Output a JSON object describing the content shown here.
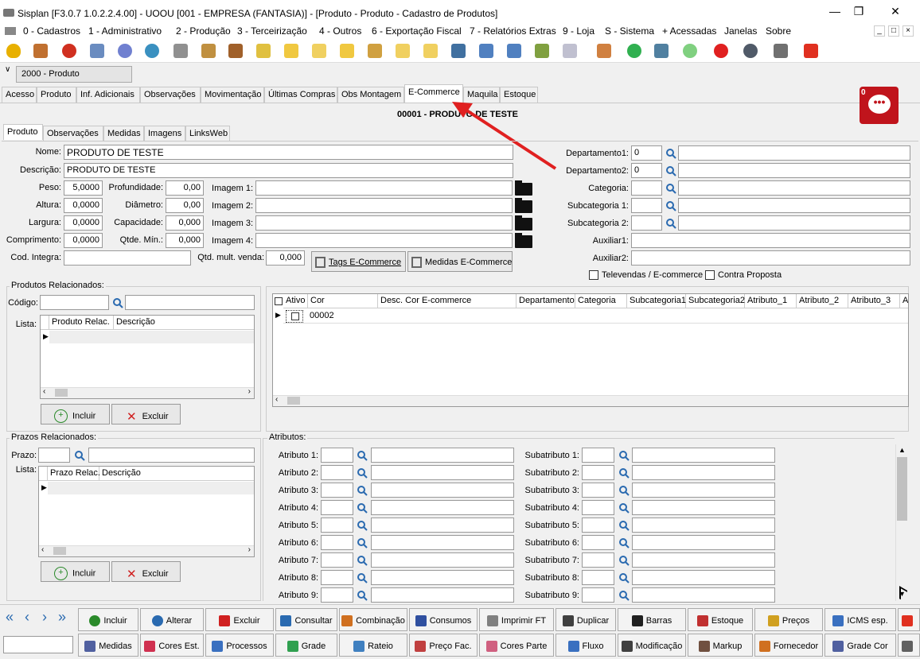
{
  "window": {
    "title": "Sisplan [F3.0.7 1.0.2.2.4.00] - UOOU [001 - EMPRESA (FANTASIA)] - [Produto - Produto - Cadastro de Produtos]"
  },
  "menu": [
    "0 - Cadastros",
    "1 - Administrativo",
    "2 - Produção",
    "3 - Terceirização",
    "4 - Outros",
    "6 - Exportação Fiscal",
    "7 - Relatórios Extras",
    "9 - Loja",
    "S - Sistema",
    "+ Acessadas",
    "Janelas",
    "Sobre"
  ],
  "form_selector": "2000 - Produto",
  "tabs": [
    "Acesso",
    "Produto",
    "Inf. Adicionais",
    "Observações",
    "Movimentação",
    "Últimas Compras",
    "Obs Montagem",
    "E-Commerce",
    "Maquila",
    "Estoque"
  ],
  "active_tab": "E-Commerce",
  "record_title": "00001 - PRODUTO DE TESTE",
  "subtabs": [
    "Produto",
    "Observações",
    "Medidas",
    "Imagens",
    "LinksWeb"
  ],
  "chat_count": "0",
  "fields": {
    "nome_label": "Nome:",
    "nome": "PRODUTO DE TESTE",
    "descricao_label": "Descrição:",
    "descricao": "PRODUTO DE TESTE",
    "peso_label": "Peso:",
    "peso": "5,0000",
    "altura_label": "Altura:",
    "altura": "0,0000",
    "largura_label": "Largura:",
    "largura": "0,0000",
    "comprimento_label": "Comprimento:",
    "comprimento": "0,0000",
    "profundidade_label": "Profundidade:",
    "profundidade": "0,00",
    "diametro_label": "Diâmetro:",
    "diametro": "0,00",
    "capacidade_label": "Capacidade:",
    "capacidade": "0,000",
    "qtde_min_label": "Qtde. Mín.:",
    "qtde_min": "0,000",
    "imagem1_label": "Imagem 1:",
    "imagem2_label": "Imagem 2:",
    "imagem3_label": "Imagem 3:",
    "imagem4_label": "Imagem 4:",
    "cod_integra_label": "Cod. Integra:",
    "qtd_mult_label": "Qtd. mult. venda:",
    "qtd_mult": "0,000",
    "tags_btn": "Tags E-Commerce",
    "medidas_btn": "Medidas E-Commerce",
    "dep1_label": "Departamento1:",
    "dep1": "0",
    "dep2_label": "Departamento2:",
    "dep2": "0",
    "categoria_label": "Categoria:",
    "subcat1_label": "Subcategoria 1:",
    "subcat2_label": "Subcategoria 2:",
    "aux1_label": "Auxiliar1:",
    "aux2_label": "Auxiliar2:",
    "televendas_label": "Televendas / E-commerce",
    "contra_label": "Contra Proposta"
  },
  "produtos_rel": {
    "title": "Produtos Relacionados:",
    "codigo_label": "Código:",
    "lista_label": "Lista:",
    "cols": [
      "Produto Relac.",
      "Descrição"
    ],
    "incluir": "Incluir",
    "excluir": "Excluir"
  },
  "cores_grid": {
    "cols": [
      "Ativo",
      "Cor",
      "Desc. Cor E-commerce",
      "Departamento",
      "Categoria",
      "Subcategoria1",
      "Subcategoria2",
      "Atributo_1",
      "Atributo_2",
      "Atributo_3",
      "At"
    ],
    "row_cor": "00002"
  },
  "prazos_rel": {
    "title": "Prazos Relacionados:",
    "prazo_label": "Prazo:",
    "lista_label": "Lista:",
    "cols": [
      "Prazo Relac.",
      "Descrição"
    ],
    "incluir": "Incluir",
    "excluir": "Excluir"
  },
  "atributos": {
    "title": "Atributos:",
    "atributos": [
      "Atributo 1:",
      "Atributo 2:",
      "Atributo 3:",
      "Atributo 4:",
      "Atributo 5:",
      "Atributo 6:",
      "Atributo 7:",
      "Atributo 8:",
      "Atributo 9:"
    ],
    "subatributos": [
      "Subatributo 1:",
      "Subatributo 2:",
      "Subatributo 3:",
      "Subatributo 4:",
      "Subatributo 5:",
      "Subatributo 6:",
      "Subatributo 7:",
      "Subatributo 8:",
      "Subatributo 9:"
    ]
  },
  "bottom_row1": [
    "Incluir",
    "Alterar",
    "Excluir",
    "Consultar",
    "Combinação",
    "Consumos",
    "Imprimir FT",
    "Duplicar",
    "Barras",
    "Estoque",
    "Preços",
    "ICMS esp."
  ],
  "bottom_row2": [
    "Medidas",
    "Cores Est.",
    "Processos",
    "Grade",
    "Rateio",
    "Preço Fac.",
    "Cores Parte",
    "Fluxo",
    "Modificação",
    "Markup",
    "Fornecedor",
    "Grade Cor"
  ],
  "nav": [
    "«",
    "‹",
    "›",
    "»"
  ],
  "colors": {
    "accent_red": "#c0141c",
    "arrow_red": "#e02020"
  }
}
